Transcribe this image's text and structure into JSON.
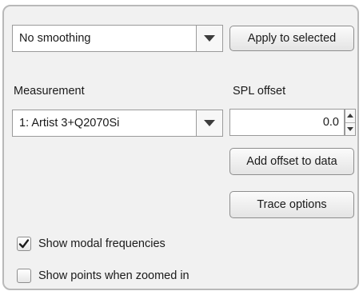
{
  "smoothing": {
    "value": "No  smoothing",
    "apply_label": "Apply to selected"
  },
  "measurement": {
    "label": "Measurement",
    "value": "1: Artist 3+Q2070Si"
  },
  "spl_offset": {
    "label": "SPL offset",
    "value": "0.0",
    "add_label": "Add offset to data"
  },
  "trace_options_label": "Trace options",
  "options": {
    "modal": {
      "label": "Show modal frequencies",
      "checked": true
    },
    "points": {
      "label": "Show points when zoomed in",
      "checked": false
    }
  },
  "icons": {
    "dropdown": "chevron-down-icon",
    "spin_up": "spin-up-icon",
    "spin_down": "spin-down-icon",
    "check": "checkmark-icon"
  }
}
